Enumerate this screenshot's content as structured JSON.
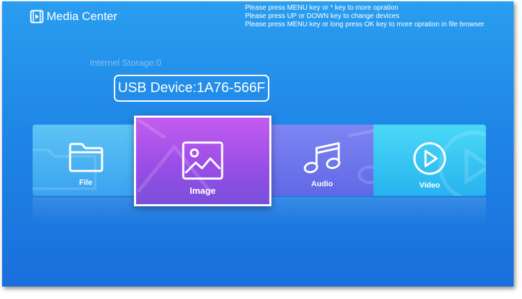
{
  "app": {
    "title": "Media Center",
    "icon": "play-film-icon"
  },
  "hints": [
    "Please press MENU key or * key to more opration",
    "Please press UP or DOWN key to change devices",
    "Please press MENU key or long press OK key to more opration in file browser"
  ],
  "storage": {
    "internal_label": "Internel Storage:0",
    "selected_device": "USB Device:1A76-566F"
  },
  "tiles": [
    {
      "label": "File",
      "icon": "folder-icon",
      "color": "#4bb4f3"
    },
    {
      "label": "Image",
      "icon": "image-icon",
      "color": "#a855ea",
      "selected": true
    },
    {
      "label": "Audio",
      "icon": "music-note-icon",
      "color": "#6f77ec"
    },
    {
      "label": "Video",
      "icon": "play-circle-icon",
      "color": "#35c6f3"
    }
  ],
  "colors": {
    "background": "#1f86e6",
    "focus_border": "#ffffff"
  }
}
